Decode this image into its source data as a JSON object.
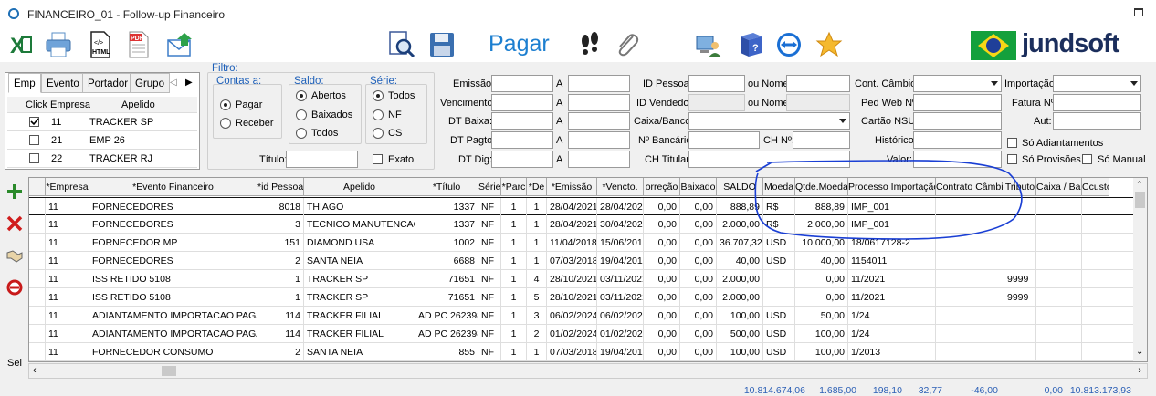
{
  "window": {
    "title": "FINANCEIRO_01 - Follow-up Financeiro"
  },
  "toolbar": {
    "icons": [
      "excel-icon",
      "print-icon",
      "html-icon",
      "pdf-icon",
      "email-export-icon",
      "search-document-icon",
      "save-icon",
      "footsteps-icon",
      "attachment-icon",
      "computer-user-icon",
      "help-book-icon",
      "teamviewer-icon",
      "favorite-star-icon"
    ],
    "pagar_label": "Pagar",
    "brand": "jundsoft"
  },
  "tabs": {
    "items": [
      "Emp",
      "Evento",
      "Portador",
      "Grupo"
    ],
    "header_click": "Click",
    "header_empresa": "Empresa",
    "header_apelido": "Apelido",
    "rows": [
      {
        "checked": true,
        "empresa": "11",
        "apelido": "TRACKER SP"
      },
      {
        "checked": false,
        "empresa": "21",
        "apelido": "EMP 26"
      },
      {
        "checked": false,
        "empresa": "22",
        "apelido": "TRACKER RJ"
      }
    ]
  },
  "filtro": {
    "title": "Filtro:",
    "contas_title": "Contas a:",
    "contas": [
      {
        "label": "Pagar",
        "selected": true
      },
      {
        "label": "Receber",
        "selected": false
      }
    ],
    "saldo_title": "Saldo:",
    "saldo": [
      {
        "label": "Abertos",
        "selected": true
      },
      {
        "label": "Baixados",
        "selected": false
      },
      {
        "label": "Todos",
        "selected": false
      }
    ],
    "serie_title": "Série:",
    "serie": [
      {
        "label": "Todos",
        "selected": true
      },
      {
        "label": "NF",
        "selected": false
      },
      {
        "label": "CS",
        "selected": false
      }
    ],
    "titulo_label": "Título:",
    "exato_label": "Exato"
  },
  "dates": {
    "emissao": "Emissão:",
    "vencimento": "Vencimento:",
    "dt_baixa": "DT Baixa:",
    "dt_pagto": "DT Pagto:",
    "dt_dig": "DT Dig:",
    "a": "A"
  },
  "pessoa": {
    "id_pessoa": "ID Pessoa:",
    "ou_nome": "ou Nome:",
    "id_vendedor": "ID Vendedor:",
    "caixa_banco": "Caixa/Banco:",
    "n_bancario": "Nº Bancário:",
    "ch_n": "CH Nº:",
    "ch_titular": "CH Titular:"
  },
  "right_filters": {
    "cont_cambio": "Cont. Câmbio:",
    "importacao": "Importação:",
    "ped_web": "Ped Web Nº:",
    "fatura": "Fatura Nº:",
    "cartao_nsu": "Cartão NSU:",
    "aut": "Aut:",
    "historico": "Histórico:",
    "valor": "Valor:",
    "so_adiantamentos": "Só Adiantamentos",
    "so_provisoes": "Só Provisões",
    "so_manual": "Só Manual"
  },
  "side_buttons": [
    "add-icon",
    "delete-icon",
    "handshake-icon",
    "cancel-circle-icon"
  ],
  "side_sel_label": "Sel",
  "grid": {
    "columns": [
      "*Empresa",
      "*Evento Financeiro",
      "*id Pessoa",
      "Apelido",
      "*Título",
      "Série",
      "*Parc",
      "*De",
      "*Emissão",
      "*Vencto.",
      "orreção",
      "Baixado",
      "SALDO",
      "Moeda",
      "Qtde.Moedas",
      "Processo Importação",
      "Contrato Câmbio",
      "Tributo",
      "Caixa / Banco",
      "Ccusto"
    ],
    "rows": [
      [
        "11",
        "FORNECEDORES",
        "8018",
        "THIAGO",
        "1337",
        "NF",
        "1",
        "1",
        "28/04/2021",
        "28/04/2021",
        "0,00",
        "0,00",
        "888,89",
        "R$",
        "888,89",
        "IMP_001",
        "",
        "",
        "",
        ""
      ],
      [
        "11",
        "FORNECEDORES",
        "3",
        "TECNICO MANUTENCAO",
        "1337",
        "NF",
        "1",
        "1",
        "28/04/2021",
        "30/04/2021",
        "0,00",
        "0,00",
        "2.000,00",
        "R$",
        "2.000,00",
        "IMP_001",
        "",
        "",
        "",
        ""
      ],
      [
        "11",
        "FORNECEDOR MP",
        "151",
        "DIAMOND USA",
        "1002",
        "NF",
        "1",
        "1",
        "11/04/2018",
        "15/06/2018",
        "0,00",
        "0,00",
        "36.707,32",
        "USD",
        "10.000,00",
        "18/0617128-2",
        "",
        "",
        "",
        ""
      ],
      [
        "11",
        "FORNECEDORES",
        "2",
        "SANTA NEIA",
        "6688",
        "NF",
        "1",
        "1",
        "07/03/2018",
        "19/04/2018",
        "0,00",
        "0,00",
        "40,00",
        "USD",
        "40,00",
        "1154011",
        "",
        "",
        "",
        ""
      ],
      [
        "11",
        "ISS RETIDO 5108",
        "1",
        "TRACKER SP",
        "71651",
        "NF",
        "1",
        "4",
        "28/10/2021",
        "03/11/2021",
        "0,00",
        "0,00",
        "2.000,00",
        "",
        "0,00",
        "11/2021",
        "",
        "9999",
        "",
        ""
      ],
      [
        "11",
        "ISS RETIDO 5108",
        "1",
        "TRACKER SP",
        "71651",
        "NF",
        "1",
        "5",
        "28/10/2021",
        "03/11/2021",
        "0,00",
        "0,00",
        "2.000,00",
        "",
        "0,00",
        "11/2021",
        "",
        "9999",
        "",
        ""
      ],
      [
        "11",
        "ADIANTAMENTO IMPORTACAO PAGAR",
        "114",
        "TRACKER FILIAL",
        "AD PC 262398",
        "NF",
        "1",
        "3",
        "06/02/2024",
        "06/02/2024",
        "0,00",
        "0,00",
        "100,00",
        "USD",
        "50,00",
        "1/24",
        "",
        "",
        "",
        ""
      ],
      [
        "11",
        "ADIANTAMENTO IMPORTACAO PAGAR",
        "114",
        "TRACKER FILIAL",
        "AD PC 262398",
        "NF",
        "1",
        "2",
        "01/02/2024",
        "01/02/2024",
        "0,00",
        "0,00",
        "500,00",
        "USD",
        "100,00",
        "1/24",
        "",
        "",
        "",
        ""
      ],
      [
        "11",
        "FORNECEDOR CONSUMO",
        "2",
        "SANTA NEIA",
        "855",
        "NF",
        "1",
        "1",
        "07/03/2018",
        "19/04/2018",
        "0,00",
        "0,00",
        "100,00",
        "USD",
        "100,00",
        "1/2013",
        "",
        "",
        "",
        ""
      ]
    ]
  },
  "totals": [
    "10.814.674,06",
    "1.685,00",
    "198,10",
    "32,77",
    "-46,00",
    "0,00",
    "10.813.173,93"
  ],
  "annotation_color": "#1a3fd4"
}
